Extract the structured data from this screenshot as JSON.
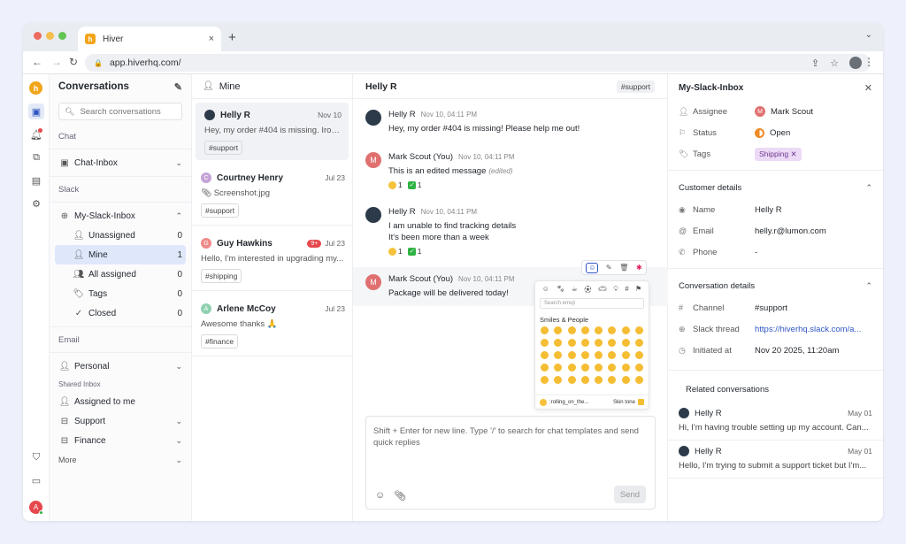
{
  "browser": {
    "tab_title": "Hiver",
    "tab_close": "×",
    "new_tab": "+",
    "url": "app.hiverhq.com/",
    "favicon": "h",
    "profile_initial": "●"
  },
  "colors": {
    "accent": "#2f55c2",
    "brand": "#f2a51a",
    "danger": "#e5484d",
    "success": "#2fb344"
  },
  "rail": {
    "logo": "h",
    "me_initial": "A"
  },
  "sidebar": {
    "title": "Conversations",
    "search_placeholder": "Search conversations",
    "section_chat": "Chat",
    "chat_inbox": "Chat-Inbox",
    "section_slack": "Slack",
    "slack_inbox": "My-Slack-Inbox",
    "slack_items": [
      {
        "label": "Unassigned",
        "count": "0"
      },
      {
        "label": "Mine",
        "count": "1"
      },
      {
        "label": "All assigned",
        "count": "0"
      },
      {
        "label": "Tags",
        "count": "0"
      },
      {
        "label": "Closed",
        "count": "0"
      }
    ],
    "section_email": "Email",
    "personal": "Personal",
    "shared_inbox": "Shared Inbox",
    "assigned_to_me": "Assigned to me",
    "support": "Support",
    "finance": "Finance",
    "more": "More"
  },
  "list": {
    "title": "Mine",
    "items": [
      {
        "name": "Helly R",
        "date": "Nov 10",
        "snippet": "Hey, my order #404 is missing. Ironic...",
        "tag": "#support",
        "initial": "",
        "color": "#2d3a4a"
      },
      {
        "name": "Courtney Henry",
        "date": "Jul 23",
        "snippet": "Screenshot.jpg",
        "tag": "#support",
        "initial": "C",
        "color": "#c5a3d6"
      },
      {
        "name": "Guy Hawkins",
        "date": "Jul 23",
        "badge": "9+",
        "snippet": "Hello, I'm interested in upgrading my...",
        "tag": "#shipping",
        "initial": "G",
        "color": "#ef8a8a"
      },
      {
        "name": "Arlene McCoy",
        "date": "Jul 23",
        "snippet": "Awesome thanks 🙏",
        "tag": "#finance",
        "initial": "A",
        "color": "#8fd1b0"
      }
    ]
  },
  "chat": {
    "title": "Helly R",
    "channel_tag": "#support",
    "messages": [
      {
        "name": "Helly R",
        "time": "Nov 10, 04:11 PM",
        "text": "Hey, my order #404 is missing! Please help me out!"
      },
      {
        "name": "Mark Scout (You)",
        "time": "Nov 10, 04:11 PM",
        "text": "This is an edited message",
        "edited": "(edited)",
        "r1": "1",
        "r2": "1"
      },
      {
        "name": "Helly R",
        "time": "Nov 10, 04:11 PM",
        "text": "I am unable to find tracking details",
        "text2": "It's been more than a week",
        "r1": "1",
        "r2": "1"
      },
      {
        "name": "Mark Scout (You)",
        "time": "Nov 10, 04:11 PM",
        "text": "Package will be delivered today!"
      }
    ],
    "me_initial": "M",
    "emoji_picker": {
      "search_placeholder": "Search emoji",
      "category": "Smiles & People",
      "preview": ":rolling_on_the...",
      "skin_tone": "Skin tone"
    },
    "composer_placeholder": "Shift + Enter for new line. Type '/' to search for chat templates and send quick replies",
    "send_label": "Send"
  },
  "details": {
    "inbox": "My-Slack-Inbox",
    "assignee_label": "Assignee",
    "assignee": "Mark Scout",
    "status_label": "Status",
    "status": "Open",
    "tags_label": "Tags",
    "tag": "Shipping",
    "customer_section": "Customer details",
    "name_label": "Name",
    "name": "Helly R",
    "email_label": "Email",
    "email": "helly.r@lumon.com",
    "phone_label": "Phone",
    "phone": "-",
    "conv_section": "Conversation details",
    "channel_label": "Channel",
    "channel": "#support",
    "thread_label": "Slack thread",
    "thread": "https://hiverhq.slack.com/a...",
    "initiated_label": "Initiated at",
    "initiated": "Nov 20 2025, 11:20am",
    "related_title": "Related conversations",
    "related": [
      {
        "name": "Helly R",
        "date": "May 01",
        "snippet": "Hi, I'm having trouble setting up my account. Can..."
      },
      {
        "name": "Helly R",
        "date": "May 01",
        "snippet": "Hello, I'm trying to submit a support ticket but I'm..."
      }
    ]
  }
}
